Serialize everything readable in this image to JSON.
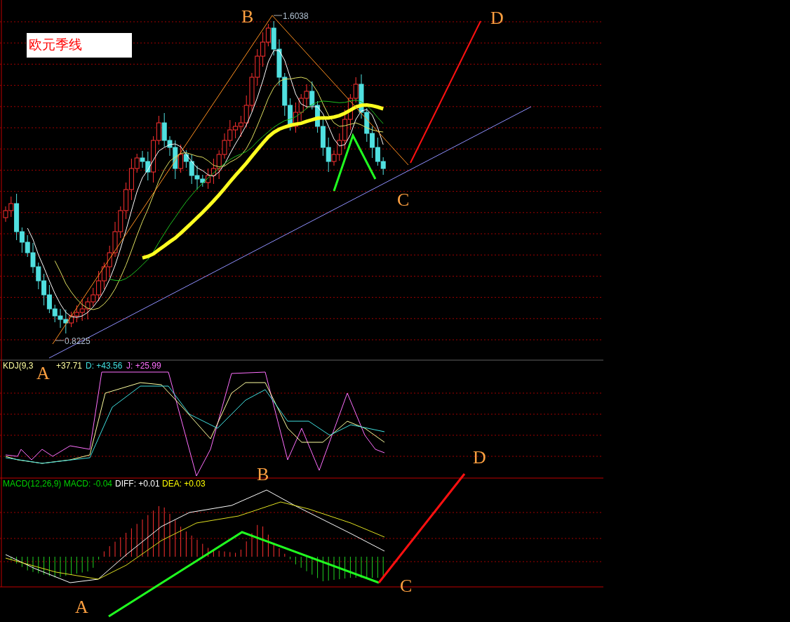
{
  "title": "欧元季线",
  "price_panel": {
    "high_label": "1.6038",
    "low_label": "0.8225",
    "wave_labels": [
      "A",
      "B",
      "C",
      "D"
    ]
  },
  "kdj_panel": {
    "values": [
      "KDJ(9,3",
      "+37.71",
      "D: +43.56",
      "J: +25.99"
    ]
  },
  "macd_panel": {
    "values": [
      "MACD(12,26,9) MACD: -0.04",
      "DIFF: +0.01",
      "DEA: +0.03"
    ],
    "wave_labels": [
      "A",
      "B",
      "C",
      "D"
    ]
  }
}
